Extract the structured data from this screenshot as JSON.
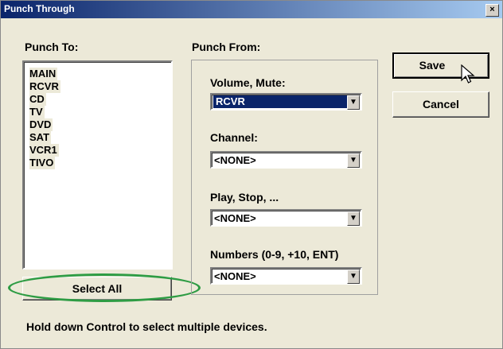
{
  "window": {
    "title": "Punch Through",
    "close_glyph": "×"
  },
  "punch_to": {
    "label": "Punch To:",
    "items": [
      "MAIN",
      "RCVR",
      "CD",
      "TV",
      "DVD",
      "SAT",
      "VCR1",
      "TIVO"
    ],
    "select_all_label": "Select All"
  },
  "punch_from": {
    "label": "Punch From:",
    "volume": {
      "label": "Volume, Mute:",
      "value": "RCVR"
    },
    "channel": {
      "label": "Channel:",
      "value": "<NONE>"
    },
    "play": {
      "label": "Play, Stop, ...",
      "value": "<NONE>"
    },
    "numbers": {
      "label": "Numbers (0-9, +10, ENT)",
      "value": "<NONE>"
    }
  },
  "buttons": {
    "save": "Save",
    "cancel": "Cancel"
  },
  "footer": {
    "hint": "Hold down Control to select multiple devices."
  },
  "colors": {
    "title_start": "#0a246a",
    "title_end": "#a6caf0",
    "selection": "#0a246a",
    "annotation": "#2e9c44"
  }
}
